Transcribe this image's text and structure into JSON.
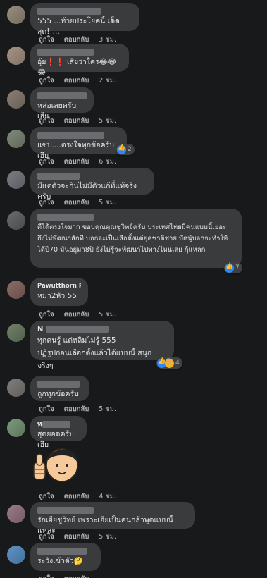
{
  "labels": {
    "like": "ถูกใจ",
    "reply": "ตอบกลับ"
  },
  "comments": [
    {
      "name": "",
      "text": "555 ...ท้ายประโยคนี้ เด็ดสุด!!...",
      "time": "3 ชม."
    },
    {
      "name": "",
      "text": "อุ้ย❗❗ เสียว่าใคร😂😂😂",
      "time": "2 ชม."
    },
    {
      "name": "",
      "text": "หล่อเลยครับเฮีย",
      "time": "5 ชม."
    },
    {
      "name": "",
      "text": "แซ่บ....ตรงใจทุกข้อครับเฮีย",
      "time": "6 ชม.",
      "reaction_count": "2"
    },
    {
      "name": "",
      "text": "มีแต่ตัวจะกินไม่มีตัวแก้ที่แท้จริงครับ",
      "time": "5 ชม."
    },
    {
      "name": "",
      "text": "ดีได้ตรงใจมาก ขอบคุณคุณชูวิทย์ครับ ประเทศไทยมีคนแบบนี้เยอะ ถึงไม่พัฒนาสักที บอกจะเป็นเสือตั้งแต่ยุคชาติชาย บัดนู้บอกจะทำให้ได้ปี70 มันอยู่มา8ปี ยังไม่รู้จะพัฒนาไปทางไหนเลย กุ้แหลก",
      "time": "",
      "reaction_count": "7"
    },
    {
      "name": "Pawutthorn Pumpanrat",
      "text": "หมา2หัว 55",
      "time": "5 ชม."
    },
    {
      "name": "N",
      "text": "ทุกคนรู้ แต่หลิมไม่รู้ 555\nปฏิรูปก่อนเลือกตั้งแล้วได้แบบนี้ สนุกจริงๆ",
      "time": "",
      "reaction_count": "4"
    },
    {
      "name": "",
      "text": "ถูกทุกข้อครับ",
      "time": "5 ชม."
    },
    {
      "name": "ห",
      "text": "สุดยอดครับเฮีย",
      "time": "4 ชม."
    },
    {
      "name": "",
      "text": "รักเฮียชูวิทย์ เพราะเฮียเป็นคนกล้าพูดแบบนี้แหละ",
      "time": "5 ชม."
    },
    {
      "name": "",
      "text": "ระวังเข้าตัว🤔",
      "time": ""
    }
  ],
  "colors": {
    "background": "#18191a",
    "bubble": "#3a3b3c",
    "text": "#e4e6eb",
    "secondary": "#b0b3b8",
    "like_blue": "#2d88ff"
  }
}
